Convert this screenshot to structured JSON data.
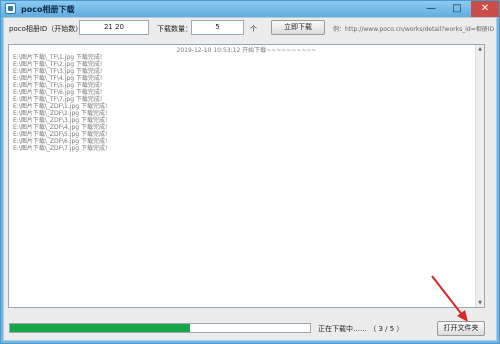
{
  "window": {
    "title": "poco相册下载",
    "minimize_symbol": "—",
    "maximize_symbol": "□",
    "close_symbol": "✕"
  },
  "form": {
    "album_id_label": "poco相册ID（开始数）：",
    "album_id_value": "21 20",
    "download_count_label": "下载数量：",
    "download_count_value": "5",
    "download_count_suffix": "个",
    "download_button_label": "立即下载",
    "example_text": "例：http://www.poco.cn/works/detail?works_id=相册ID"
  },
  "log": {
    "header": "2019-12-10 10:53:12 开始下载~~~~~~~~~~",
    "lines": [
      "E:\\图片下载\\_TF\\1.jpg 下载完成!",
      "E:\\图片下载\\_TF\\2.jpg 下载完成!",
      "E:\\图片下载\\_TF\\3.jpg 下载完成!",
      "E:\\图片下载\\_TF\\4.jpg 下载完成!",
      "E:\\图片下载\\_TF\\5.jpg 下载完成!",
      "E:\\图片下载\\_TF\\6.jpg 下载完成!",
      "E:\\图片下载\\_TF\\7.jpg 下载完成!",
      "E:\\图片下载\\_ZDF\\1.jpg 下载完成!",
      "E:\\图片下载\\_ZDF\\2.jpg 下载完成!",
      "E:\\图片下载\\_ZDF\\3.jpg 下载完成!",
      "E:\\图片下载\\_ZDF\\4.jpg 下载完成!",
      "E:\\图片下载\\_ZDF\\5.jpg 下载完成!",
      "E:\\图片下载\\_ZDF\\6.jpg 下载完成!",
      "E:\\图片下载\\_ZDF\\7.jpg 下载完成!"
    ]
  },
  "status": {
    "progress_fraction": 0.6,
    "text": "正在下载中…… （ 3 / 5 ）",
    "open_folder_label": "打开文件夹"
  },
  "colors": {
    "progress_fill": "#16a846",
    "annotation_arrow": "#d62828",
    "titlebar": "#6fb7e6"
  },
  "scrollbar": {
    "up_symbol": "▲",
    "down_symbol": "▼"
  }
}
